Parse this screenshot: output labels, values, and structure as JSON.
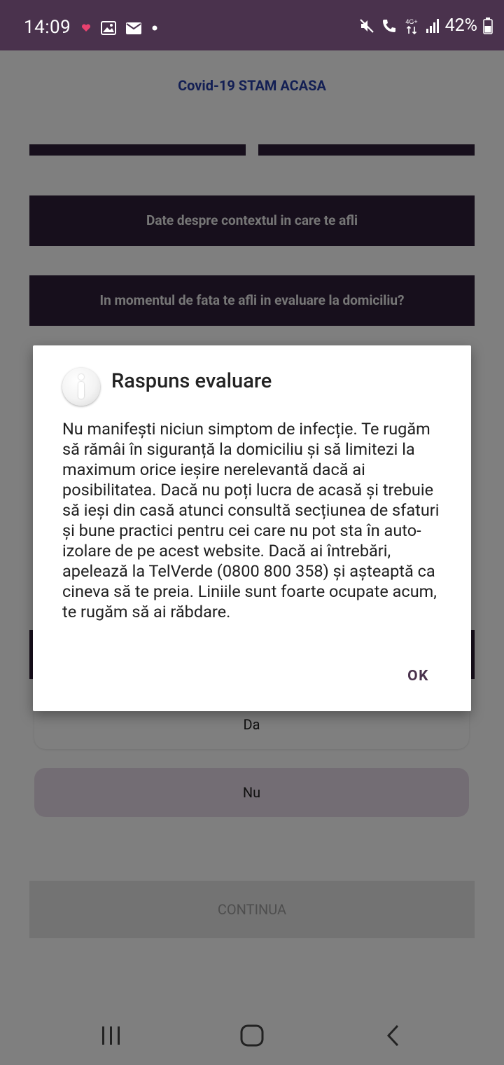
{
  "status_bar": {
    "time": "14:09",
    "battery_percent": "42%",
    "network_label": "4G+",
    "left_icons": [
      "heart-icon",
      "image-icon",
      "mail-icon",
      "dot-icon"
    ],
    "right_icons": [
      "mute-icon",
      "call-icon",
      "network-4g-icon",
      "signal-icon",
      "battery-icon"
    ]
  },
  "app_bar": {
    "title": "Covid-19 STAM ACASA"
  },
  "form": {
    "section_header": "Date despre contextul in care te afli",
    "question": "In momentul de fata te afli in evaluare la domiciliu?",
    "options": [
      {
        "label": "Da",
        "selected": false
      },
      {
        "label": "Nu",
        "selected": true
      }
    ],
    "continue_label": "CONTINUA"
  },
  "dialog": {
    "icon": "info-icon",
    "title": "Raspuns evaluare",
    "message": "Nu manifești niciun simptom de infecție. Te rugăm să rămâi în siguranță la domiciliu și să limitezi la maximum orice ieșire nerelevantă dacă ai posibilitatea. Dacă nu poți lucra de acasă și trebuie să ieși din casă atunci consultă secțiunea de sfaturi și bune practici pentru cei care nu pot sta în auto-izolare de pe acest website. Dacă ai întrebări, apelează la TelVerde (0800 800 358) și așteaptă ca cineva să te preia. Liniile sunt foarte ocupate acum, te rugăm să ai răbdare.",
    "ok_label": "OK"
  },
  "nav_bar": {
    "icons": [
      "recent-apps-icon",
      "home-icon",
      "back-icon"
    ]
  },
  "colors": {
    "status_bar": "#4a324d",
    "app_title": "#263fa8",
    "dark_section": "#2e1f38",
    "selected_option": "#e7dbe8",
    "dialog_button": "#4a324d"
  }
}
